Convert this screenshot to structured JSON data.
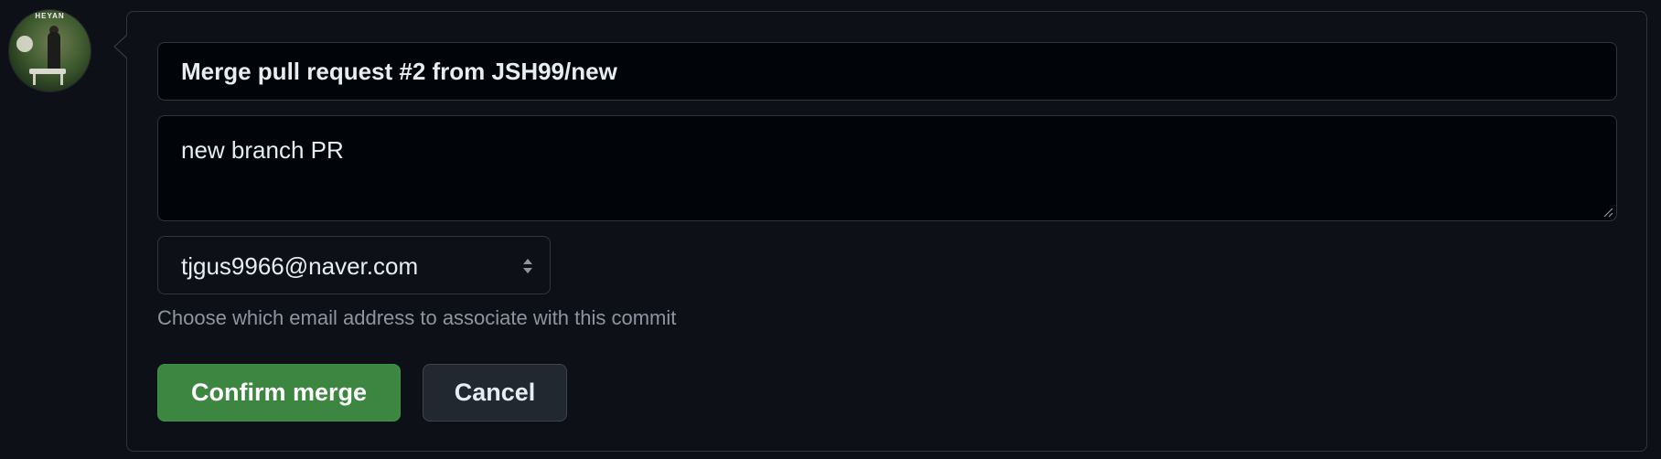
{
  "avatar": {
    "tag_text": "HEYAN",
    "accent": "#3f5a2f"
  },
  "merge_form": {
    "title_value": "Merge pull request #2 from JSH99/new",
    "body_value": "new branch PR",
    "email": {
      "selected": "tjgus9966@naver.com",
      "hint": "Choose which email address to associate with this commit"
    },
    "confirm_label": "Confirm merge",
    "cancel_label": "Cancel"
  },
  "colors": {
    "background": "#0d1117",
    "input_bg": "#010409",
    "border": "#30363d",
    "confirm_bg": "#3d8641",
    "cancel_bg": "#212830",
    "hint_text": "#8d96a0"
  },
  "icons": {
    "select_arrows": "select-arrows-icon",
    "resize_grip": "resize-grip-icon"
  }
}
